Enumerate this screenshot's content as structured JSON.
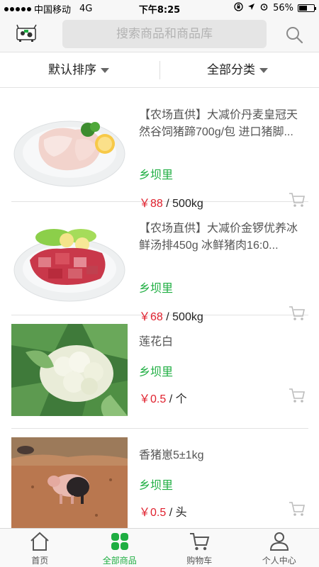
{
  "status_bar": {
    "carrier": "中国移动",
    "network": "4G",
    "time": "下午8:25",
    "battery": "56%",
    "battery_level": 0.56
  },
  "header": {
    "search_placeholder": "搜索商品和商品库"
  },
  "filters": {
    "sort_label": "默认排序",
    "category_label": "全部分类"
  },
  "products": [
    {
      "title": "【农场直供】大减价丹麦皇冠天然谷饲猪蹄700g/包 进口猪脚...",
      "seller": "乡坝里",
      "price": "￥88",
      "unit": " / 500kg"
    },
    {
      "title": "【农场直供】大减价金锣优养冰鲜汤排450g 冰鲜猪肉16:0...",
      "seller": "乡坝里",
      "price": "￥68",
      "unit": " / 500kg"
    },
    {
      "title": "莲花白",
      "seller": "乡坝里",
      "price": "￥0.5",
      "unit": " / 个"
    },
    {
      "title": "香猪崽5±1kg",
      "seller": "乡坝里",
      "price": "￥0.5",
      "unit": " / 头"
    }
  ],
  "tabbar": {
    "items": [
      {
        "label": "首页",
        "icon": "home-icon"
      },
      {
        "label": "全部商品",
        "icon": "grid-icon",
        "active": true
      },
      {
        "label": "购物车",
        "icon": "cart-icon"
      },
      {
        "label": "个人中心",
        "icon": "user-icon"
      }
    ]
  },
  "colors": {
    "accent_green": "#1fae42",
    "price_red": "#e0212e"
  }
}
